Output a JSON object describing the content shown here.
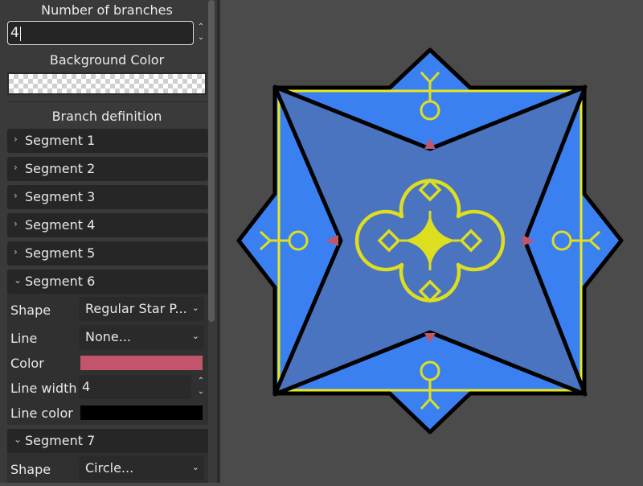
{
  "panel": {
    "branches_label": "Number of branches",
    "branches_value": "4",
    "background_label": "Background Color",
    "branch_definition_label": "Branch definition",
    "segments": [
      {
        "label": "Segment 1"
      },
      {
        "label": "Segment 2"
      },
      {
        "label": "Segment 3"
      },
      {
        "label": "Segment 4"
      },
      {
        "label": "Segment 5"
      },
      {
        "label": "Segment 6"
      },
      {
        "label": "Segment 7"
      }
    ],
    "segment6": {
      "shape_label": "Shape",
      "shape_value": "Regular Star P...",
      "line_label": "Line",
      "line_value": "None...",
      "color_label": "Color",
      "color_value": "#c2546c",
      "line_width_label": "Line width",
      "line_width_value": "4",
      "line_color_label": "Line color",
      "line_color_value": "#000000"
    },
    "segment7": {
      "shape_label": "Shape",
      "shape_value": "Circle..."
    }
  },
  "icons": {
    "collapsed": "chevron-right-icon",
    "expanded": "chevron-down-icon",
    "dropdown": "dropdown-arrow-icon",
    "spin": "spin-arrows-icon"
  },
  "colors": {
    "canvas_bg": "#4b4b4b",
    "panel_bg": "#3a3a3a",
    "star_blue": "#3b80f0",
    "inner_blue": "#4a73c0",
    "ornament_yellow": "#dede20",
    "square_yellow": "#e8e820",
    "notch_pink": "#c2546c"
  }
}
